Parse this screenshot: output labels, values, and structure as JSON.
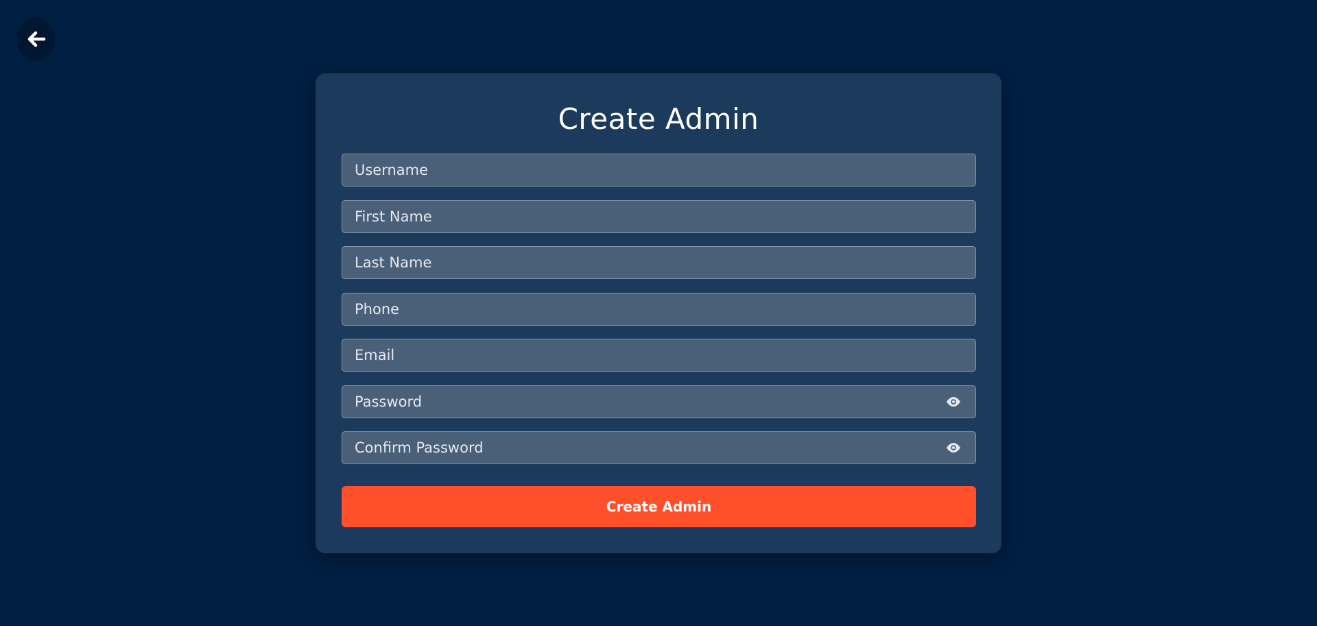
{
  "colors": {
    "background": "#001f42",
    "card": "#1c3a5c",
    "field": "#4a6079",
    "accent": "#ff4f2b"
  },
  "back": {
    "icon": "arrow-left-icon"
  },
  "form": {
    "title": "Create Admin",
    "fields": [
      {
        "placeholder": "Username",
        "value": ""
      },
      {
        "placeholder": "First Name",
        "value": ""
      },
      {
        "placeholder": "Last Name",
        "value": ""
      },
      {
        "placeholder": "Phone",
        "value": ""
      },
      {
        "placeholder": "Email",
        "value": ""
      },
      {
        "placeholder": "Password",
        "value": "",
        "icon": "eye-icon"
      },
      {
        "placeholder": "Confirm Password",
        "value": "",
        "icon": "eye-icon"
      }
    ],
    "submit_label": "Create Admin"
  }
}
